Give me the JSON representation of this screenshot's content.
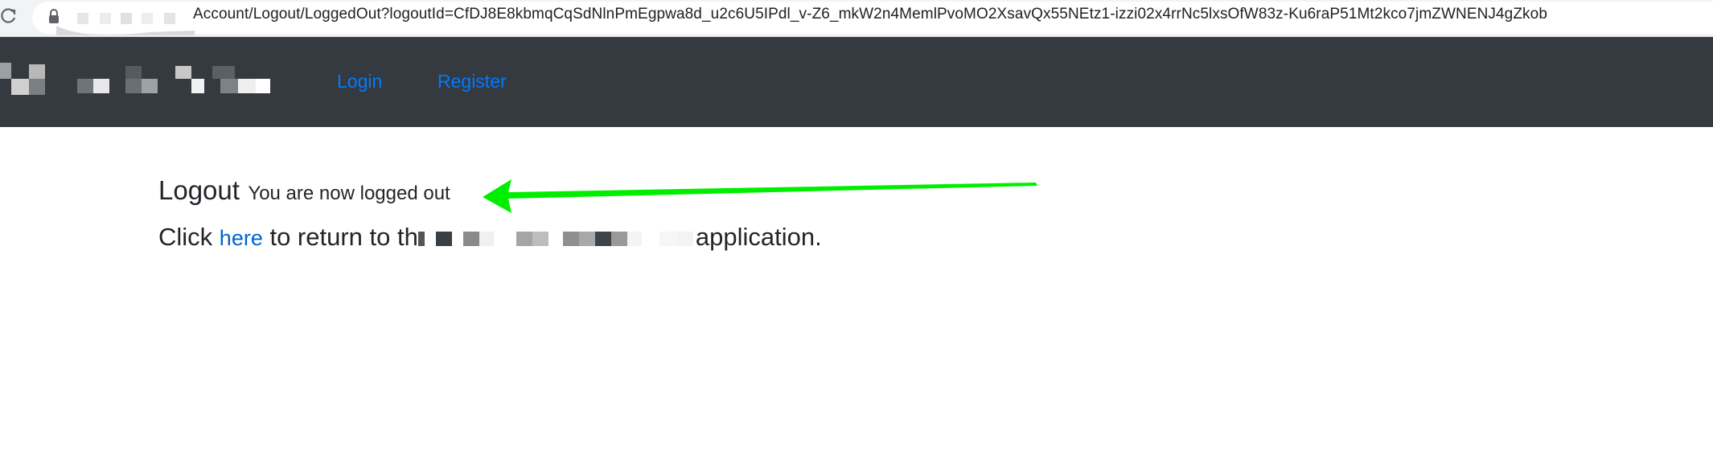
{
  "browser": {
    "url_visible": "Account/Logout/LoggedOut?logoutId=CfDJ8E8kbmqCqSdNlnPmEgpwa8d_u2c6U5IPdl_v-Z6_mkW2n4MemlPvoMO2XsavQx55NEtz1-izzi02x4rrNc5lxsOfW83z-Ku6raP51Mt2kco7jmZWNENJ4gZkob",
    "reload_icon": "reload-icon",
    "lock_icon": "lock-icon"
  },
  "navbar": {
    "links": [
      {
        "label": "Login"
      },
      {
        "label": "Register"
      }
    ],
    "background": "#343a40",
    "link_color": "#007bff"
  },
  "content": {
    "title": "Logout",
    "subtitle": "You are now logged out",
    "return_prefix": "Click",
    "return_link": "here",
    "return_middle": "to return to th",
    "return_suffix": "application."
  },
  "annotation": {
    "arrow_color": "#00ee00"
  }
}
